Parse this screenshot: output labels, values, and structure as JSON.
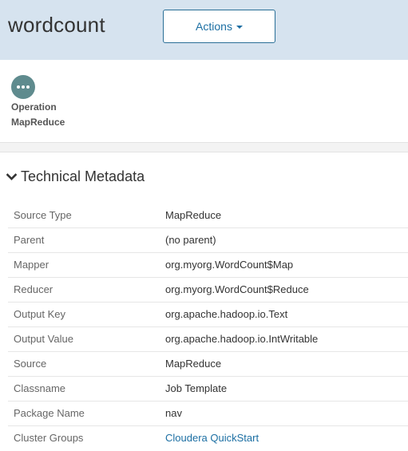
{
  "header": {
    "title": "wordcount",
    "actions_label": "Actions"
  },
  "entity": {
    "icon": "ellipsis-icon",
    "icon_color": "#5f8b8e",
    "type_line1": "Operation",
    "type_line2": "MapReduce"
  },
  "section": {
    "title": "Technical Metadata",
    "expanded": true
  },
  "metadata": [
    {
      "key": "Source Type",
      "value": "MapReduce",
      "link": false
    },
    {
      "key": "Parent",
      "value": "(no parent)",
      "link": false
    },
    {
      "key": "Mapper",
      "value": "org.myorg.WordCount$Map",
      "link": false
    },
    {
      "key": "Reducer",
      "value": "org.myorg.WordCount$Reduce",
      "link": false
    },
    {
      "key": "Output Key",
      "value": "org.apache.hadoop.io.Text",
      "link": false
    },
    {
      "key": "Output Value",
      "value": "org.apache.hadoop.io.IntWritable",
      "link": false
    },
    {
      "key": "Source",
      "value": "MapReduce",
      "link": false
    },
    {
      "key": "Classname",
      "value": "Job Template",
      "link": false
    },
    {
      "key": "Package Name",
      "value": "nav",
      "link": false
    },
    {
      "key": "Cluster Groups",
      "value": "Cloudera QuickStart",
      "link": true
    }
  ],
  "colors": {
    "header_bg": "#d6e3ef",
    "accent": "#1c6fa3"
  }
}
